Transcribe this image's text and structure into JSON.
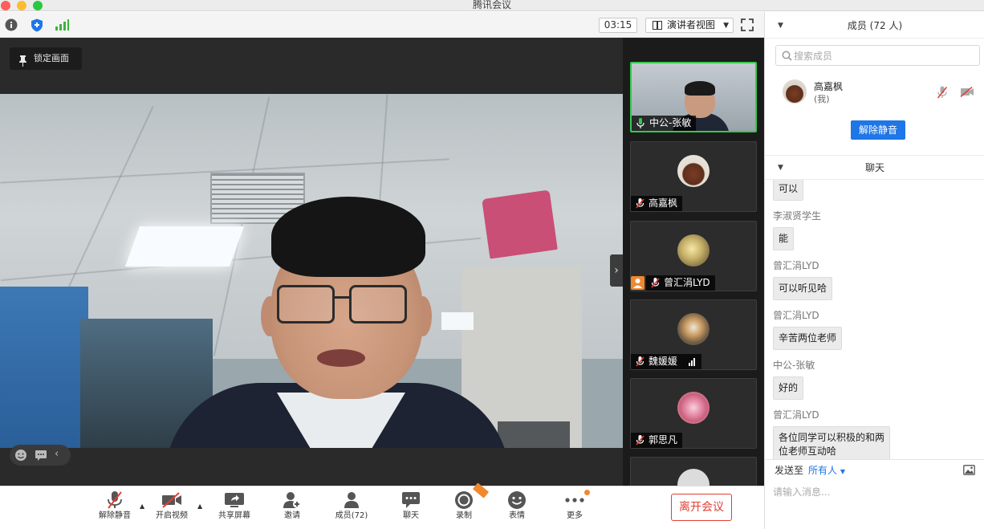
{
  "window": {
    "title": "腾讯会议"
  },
  "topbar": {
    "timer": "03:15",
    "view_mode": "演讲者视图"
  },
  "stage": {
    "pin_label": "锁定画面"
  },
  "gallery": {
    "tiles": [
      {
        "name": "中公-张敏",
        "active": true
      },
      {
        "name": "高嘉枫"
      },
      {
        "name": "曾汇涓LYD"
      },
      {
        "name": "魏媛媛"
      },
      {
        "name": "郭思凡"
      }
    ]
  },
  "toolbar": {
    "unmute": "解除静音",
    "start_video": "开启视频",
    "share_screen": "共享屏幕",
    "invite": "邀请",
    "members": "成员(72)",
    "chat": "聊天",
    "record": "录制",
    "reactions": "表情",
    "more": "更多",
    "leave": "离开会议"
  },
  "sidebar": {
    "members_header": "成员 (72 人)",
    "search_placeholder": "搜索成员",
    "me": {
      "name": "高嘉枫",
      "tag": "(我)"
    },
    "unmute_button": "解除静音",
    "chat_header": "聊天",
    "messages": [
      {
        "sender": "",
        "text": "可以"
      },
      {
        "sender": "李淑贤学生",
        "text": "能"
      },
      {
        "sender": "曾汇涓LYD",
        "text": "可以听见哈"
      },
      {
        "sender": "曾汇涓LYD",
        "text": "辛苦两位老师"
      },
      {
        "sender": "中公-张敏",
        "text": "好的"
      },
      {
        "sender": "曾汇涓LYD",
        "text": "各位同学可以积极的和两位老师互动哈"
      }
    ],
    "send_to_label": "发送至",
    "send_to_target": "所有人",
    "input_placeholder": "请输入消息..."
  },
  "colors": {
    "accent_blue": "#1f76e6",
    "leave_red": "#e33e33",
    "active_tile_green": "#37c84f"
  }
}
